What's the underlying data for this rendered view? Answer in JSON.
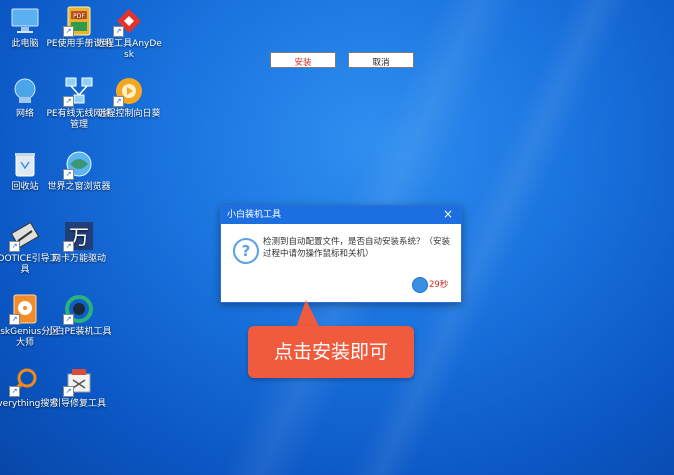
{
  "desktop_icons": [
    {
      "id": "this-pc",
      "label": "此电脑",
      "icon": "computer-icon",
      "shortcut": false
    },
    {
      "id": "pe-guide",
      "label": "PE使用手册说明",
      "icon": "pdf-icon",
      "shortcut": true
    },
    {
      "id": "anydesk",
      "label": "远程工具AnyDesk",
      "icon": "anydesk-icon",
      "shortcut": true
    },
    {
      "id": "network",
      "label": "网络",
      "icon": "network-icon",
      "shortcut": false
    },
    {
      "id": "pe-net-mgr",
      "label": "PE有线无线网络管理",
      "icon": "network-manager-icon",
      "shortcut": true
    },
    {
      "id": "remote-assist",
      "label": "远程控制向日葵",
      "icon": "sunflower-icon",
      "shortcut": true
    },
    {
      "id": "recycle-bin",
      "label": "回收站",
      "icon": "recycle-bin-icon",
      "shortcut": false
    },
    {
      "id": "browser",
      "label": "世界之窗浏览器",
      "icon": "globe-icon",
      "shortcut": true
    },
    {
      "id": "bootice",
      "label": "BOOTICE引导工具",
      "icon": "bootice-icon",
      "shortcut": true
    },
    {
      "id": "driver",
      "label": "网卡万能驱动",
      "icon": "wan-icon",
      "shortcut": true
    },
    {
      "id": "diskgenius",
      "label": "DiskGenius分区大师",
      "icon": "diskgenius-icon",
      "shortcut": true
    },
    {
      "id": "xiaobai-installer",
      "label": "小白PE装机工具",
      "icon": "installer-icon",
      "shortcut": true
    },
    {
      "id": "everything",
      "label": "Everything搜索",
      "icon": "search-icon",
      "shortcut": true
    },
    {
      "id": "boot-repair",
      "label": "引导修复工具",
      "icon": "repair-icon",
      "shortcut": true
    }
  ],
  "dialog": {
    "title": "小白装机工具",
    "close_label": "×",
    "message": "检测到自动配置文件，是否自动安装系统？（安装过程中请勿操作鼠标和关机）",
    "install_label": "安装",
    "cancel_label": "取消",
    "countdown": "29秒"
  },
  "callout": {
    "text": "点击安装即可"
  },
  "colors": {
    "accent": "#1c6fe0",
    "callout": "#ef5b3c",
    "danger": "#d52b2b"
  }
}
